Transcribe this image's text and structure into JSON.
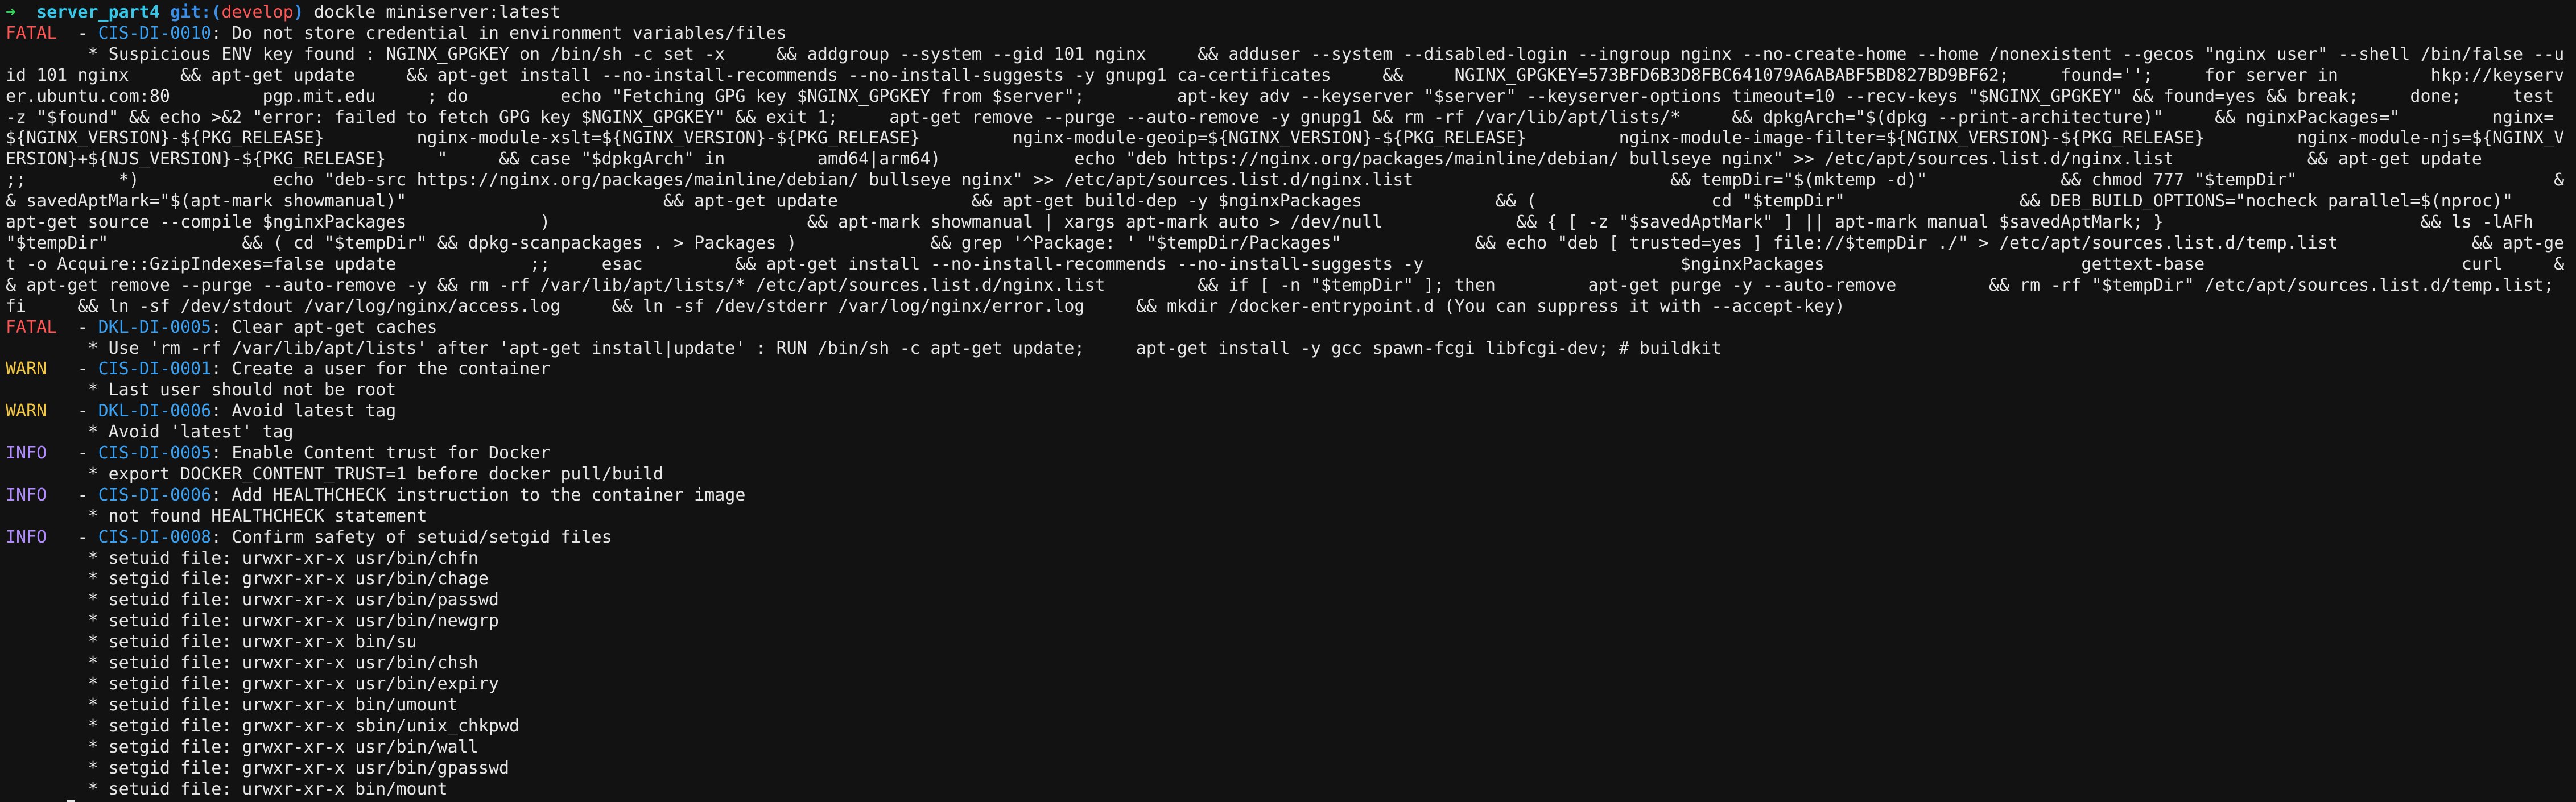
{
  "prompt": {
    "arrow": "➜",
    "dir": "server_part4",
    "git_label": "git:",
    "branch_open": "(",
    "branch": "develop",
    "branch_close": ")",
    "command": " dockle miniserver:latest"
  },
  "colors": {
    "background": "#121212",
    "FATAL": "#ff5555",
    "WARN": "#f2c744",
    "INFO": "#b18cff",
    "code": "#3aa0f2",
    "prompt_arrow": "#36d25a",
    "prompt_dir": "#36c6e8",
    "prompt_git": "#3b8fe8"
  },
  "results": [
    {
      "level": "FATAL",
      "code": "CIS-DI-0010",
      "title": "Do not store credential in environment variables/files",
      "details": [
        "* Suspicious ENV key found : NGINX_GPGKEY on /bin/sh -c set -x     && addgroup --system --gid 101 nginx     && adduser --system --disabled-login --ingroup nginx --no-create-home --home /nonexistent --gecos \"nginx user\" --shell /bin/false --uid 101 nginx     && apt-get update     && apt-get install --no-install-recommends --no-install-suggests -y gnupg1 ca-certificates     &&     NGINX_GPGKEY=573BFD6B3D8FBC641079A6ABABF5BD827BD9BF62;     found='';     for server in         hkp://keyserver.ubuntu.com:80         pgp.mit.edu     ; do         echo \"Fetching GPG key $NGINX_GPGKEY from $server\";         apt-key adv --keyserver \"$server\" --keyserver-options timeout=10 --recv-keys \"$NGINX_GPGKEY\" && found=yes && break;     done;     test -z \"$found\" && echo >&2 \"error: failed to fetch GPG key $NGINX_GPGKEY\" && exit 1;     apt-get remove --purge --auto-remove -y gnupg1 && rm -rf /var/lib/apt/lists/*     && dpkgArch=\"$(dpkg --print-architecture)\"     && nginxPackages=\"         nginx=${NGINX_VERSION}-${PKG_RELEASE}         nginx-module-xslt=${NGINX_VERSION}-${PKG_RELEASE}         nginx-module-geoip=${NGINX_VERSION}-${PKG_RELEASE}         nginx-module-image-filter=${NGINX_VERSION}-${PKG_RELEASE}         nginx-module-njs=${NGINX_VERSION}+${NJS_VERSION}-${PKG_RELEASE}     \"     && case \"$dpkgArch\" in         amd64|arm64)             echo \"deb https://nginx.org/packages/mainline/debian/ bullseye nginx\" >> /etc/apt/sources.list.d/nginx.list             && apt-get update             ;;         *)             echo \"deb-src https://nginx.org/packages/mainline/debian/ bullseye nginx\" >> /etc/apt/sources.list.d/nginx.list                         && tempDir=\"$(mktemp -d)\"             && chmod 777 \"$tempDir\"                         && savedAptMark=\"$(apt-mark showmanual)\"                         && apt-get update             && apt-get build-dep -y $nginxPackages             && (                 cd \"$tempDir\"                 && DEB_BUILD_OPTIONS=\"nocheck parallel=$(nproc)\"                     apt-get source --compile $nginxPackages             )                         && apt-mark showmanual | xargs apt-mark auto > /dev/null             && { [ -z \"$savedAptMark\" ] || apt-mark manual $savedAptMark; }                         && ls -lAFh \"$tempDir\"             && ( cd \"$tempDir\" && dpkg-scanpackages . > Packages )             && grep '^Package: ' \"$tempDir/Packages\"             && echo \"deb [ trusted=yes ] file://$tempDir ./\" > /etc/apt/sources.list.d/temp.list             && apt-get -o Acquire::GzipIndexes=false update             ;;     esac         && apt-get install --no-install-recommends --no-install-suggests -y                         $nginxPackages                         gettext-base                         curl     && apt-get remove --purge --auto-remove -y && rm -rf /var/lib/apt/lists/* /etc/apt/sources.list.d/nginx.list         && if [ -n \"$tempDir\" ]; then         apt-get purge -y --auto-remove         && rm -rf \"$tempDir\" /etc/apt/sources.list.d/temp.list;     fi     && ln -sf /dev/stdout /var/log/nginx/access.log     && ln -sf /dev/stderr /var/log/nginx/error.log     && mkdir /docker-entrypoint.d (You can suppress it with --accept-key)"
      ]
    },
    {
      "level": "FATAL",
      "code": "DKL-DI-0005",
      "title": "Clear apt-get caches",
      "details": [
        "* Use 'rm -rf /var/lib/apt/lists' after 'apt-get install|update' : RUN /bin/sh -c apt-get update;     apt-get install -y gcc spawn-fcgi libfcgi-dev; # buildkit"
      ]
    },
    {
      "level": "WARN",
      "code": "CIS-DI-0001",
      "title": "Create a user for the container",
      "details": [
        "* Last user should not be root"
      ]
    },
    {
      "level": "WARN",
      "code": "DKL-DI-0006",
      "title": "Avoid latest tag",
      "details": [
        "* Avoid 'latest' tag"
      ]
    },
    {
      "level": "INFO",
      "code": "CIS-DI-0005",
      "title": "Enable Content trust for Docker",
      "details": [
        "* export DOCKER_CONTENT_TRUST=1 before docker pull/build"
      ]
    },
    {
      "level": "INFO",
      "code": "CIS-DI-0006",
      "title": "Add HEALTHCHECK instruction to the container image",
      "details": [
        "* not found HEALTHCHECK statement"
      ]
    },
    {
      "level": "INFO",
      "code": "CIS-DI-0008",
      "title": "Confirm safety of setuid/setgid files",
      "details": [
        "* setuid file: urwxr-xr-x usr/bin/chfn",
        "* setgid file: grwxr-xr-x usr/bin/chage",
        "* setuid file: urwxr-xr-x usr/bin/passwd",
        "* setuid file: urwxr-xr-x usr/bin/newgrp",
        "* setuid file: urwxr-xr-x bin/su",
        "* setuid file: urwxr-xr-x usr/bin/chsh",
        "* setgid file: grwxr-xr-x usr/bin/expiry",
        "* setuid file: urwxr-xr-x bin/umount",
        "* setgid file: grwxr-xr-x sbin/unix_chkpwd",
        "* setgid file: grwxr-xr-x usr/bin/wall",
        "* setgid file: grwxr-xr-x usr/bin/gpasswd",
        "* setuid file: urwxr-xr-x bin/mount"
      ]
    }
  ]
}
